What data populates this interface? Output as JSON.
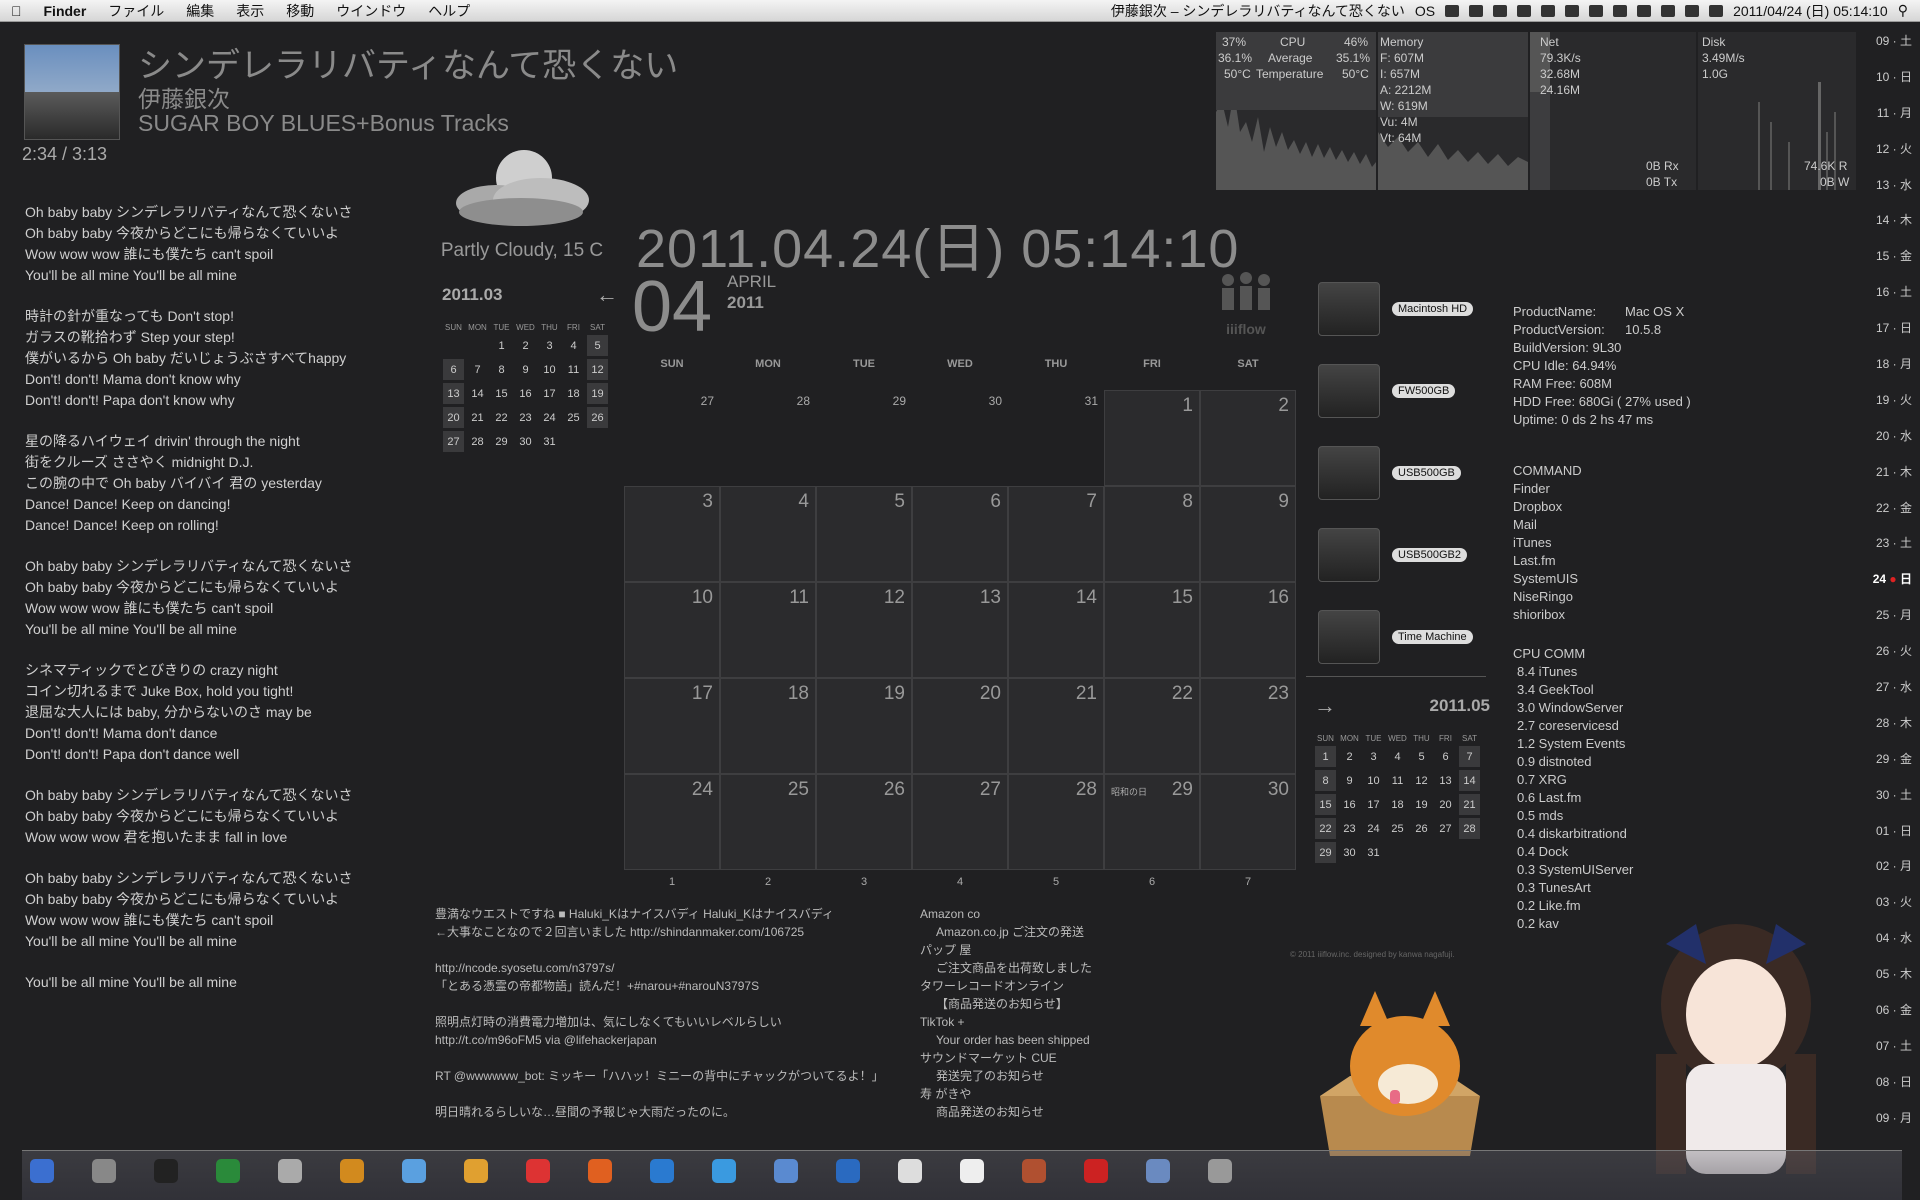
{
  "menubar": {
    "apple": "",
    "app": "Finder",
    "menus": [
      "ファイル",
      "編集",
      "表示",
      "移動",
      "ウインドウ",
      "ヘルプ"
    ],
    "now_playing": "伊藤銀次 – シンデレラリバティなんて恐くない",
    "os_label": "OS",
    "clock": "2011/04/24 (日) 05:14:10"
  },
  "now_playing": {
    "title": "シンデレラリバティなんて恐くない",
    "artist": "伊藤銀次",
    "album": "SUGAR BOY BLUES+Bonus Tracks",
    "time": "2:34 / 3:13"
  },
  "lyrics": [
    [
      "Oh baby baby シンデレラリバティなんて恐くないさ",
      "Oh baby baby 今夜からどこにも帰らなくていいよ",
      "Wow wow wow 誰にも僕たち can't spoil",
      "You'll be all mine You'll be all mine"
    ],
    [
      "時計の針が重なっても Don't stop!",
      "ガラスの靴拾わず Step your step!",
      "僕がいるから Oh baby だいじょうぶさすべてhappy",
      "Don't! don't! Mama don't know why",
      "Don't! don't! Papa don't know why"
    ],
    [
      "星の降るハイウェイ drivin' through the night",
      "街をクルーズ ささやく midnight D.J.",
      "この腕の中で Oh baby バイバイ 君の yesterday",
      "Dance! Dance! Keep on dancing!",
      "Dance! Dance! Keep on rolling!"
    ],
    [
      "Oh baby baby シンデレラリバティなんて恐くないさ",
      "Oh baby baby 今夜からどこにも帰らなくていいよ",
      "Wow wow wow 誰にも僕たち can't spoil",
      "You'll be all mine You'll be all mine"
    ],
    [
      "シネマティックでとびきりの crazy night",
      "コイン切れるまで Juke Box, hold you tight!",
      "退屈な大人には baby, 分からないのさ may be",
      "Don't! don't! Mama don't dance",
      "Don't! don't! Papa don't dance well"
    ],
    [
      "Oh baby baby シンデレラリバティなんて恐くないさ",
      "Oh baby baby 今夜からどこにも帰らなくていいよ",
      "Wow wow wow 君を抱いたまま fall in love"
    ],
    [
      "Oh baby baby シンデレラリバティなんて恐くないさ",
      "Oh baby baby 今夜からどこにも帰らなくていいよ",
      "Wow wow wow 誰にも僕たち can't spoil",
      "You'll be all mine You'll be all mine"
    ],
    [
      "You'll be all mine You'll be all mine"
    ]
  ],
  "weather": {
    "text": "Partly Cloudy, 15 C"
  },
  "mini_prev": {
    "title": "2011.03",
    "days": [
      "SUN",
      "MON",
      "TUE",
      "WED",
      "THU",
      "FRI",
      "SAT"
    ],
    "weeks": [
      [
        "",
        "",
        "1",
        "2",
        "3",
        "4",
        "5"
      ],
      [
        "6",
        "7",
        "8",
        "9",
        "10",
        "11",
        "12"
      ],
      [
        "13",
        "14",
        "15",
        "16",
        "17",
        "18",
        "19"
      ],
      [
        "20",
        "21",
        "22",
        "23",
        "24",
        "25",
        "26"
      ],
      [
        "27",
        "28",
        "29",
        "30",
        "31",
        "",
        ""
      ]
    ]
  },
  "mini_next": {
    "title": "2011.05",
    "days": [
      "SUN",
      "MON",
      "TUE",
      "WED",
      "THU",
      "FRI",
      "SAT"
    ],
    "weeks": [
      [
        "1",
        "2",
        "3",
        "4",
        "5",
        "6",
        "7"
      ],
      [
        "8",
        "9",
        "10",
        "11",
        "12",
        "13",
        "14"
      ],
      [
        "15",
        "16",
        "17",
        "18",
        "19",
        "20",
        "21"
      ],
      [
        "22",
        "23",
        "24",
        "25",
        "26",
        "27",
        "28"
      ],
      [
        "29",
        "30",
        "31",
        "",
        "",
        "",
        ""
      ]
    ]
  },
  "clock": {
    "datetime": "2011.04.24(日) 05:14:10",
    "day": "04",
    "month": "APRIL",
    "year": "2011",
    "logo": "iiiflow"
  },
  "calendar": {
    "weekdays": [
      "SUN",
      "MON",
      "TUE",
      "WED",
      "THU",
      "FRI",
      "SAT"
    ],
    "weeks": [
      [
        {
          "d": "27",
          "o": 1
        },
        {
          "d": "28",
          "o": 1
        },
        {
          "d": "29",
          "o": 1
        },
        {
          "d": "30",
          "o": 1
        },
        {
          "d": "31",
          "o": 1
        },
        {
          "d": "1"
        },
        {
          "d": "2"
        }
      ],
      [
        {
          "d": "3"
        },
        {
          "d": "4"
        },
        {
          "d": "5"
        },
        {
          "d": "6"
        },
        {
          "d": "7"
        },
        {
          "d": "8"
        },
        {
          "d": "9"
        }
      ],
      [
        {
          "d": "10"
        },
        {
          "d": "11"
        },
        {
          "d": "12"
        },
        {
          "d": "13"
        },
        {
          "d": "14"
        },
        {
          "d": "15"
        },
        {
          "d": "16"
        }
      ],
      [
        {
          "d": "17"
        },
        {
          "d": "18"
        },
        {
          "d": "19"
        },
        {
          "d": "20"
        },
        {
          "d": "21"
        },
        {
          "d": "22"
        },
        {
          "d": "23"
        }
      ],
      [
        {
          "d": "24"
        },
        {
          "d": "25"
        },
        {
          "d": "26"
        },
        {
          "d": "27"
        },
        {
          "d": "28"
        },
        {
          "d": "29",
          "h": "昭和の日"
        },
        {
          "d": "30"
        }
      ]
    ],
    "footer": [
      "1",
      "2",
      "3",
      "4",
      "5",
      "6",
      "7"
    ]
  },
  "tweets": [
    [
      "豊満なウエストですね ■ Haluki_Kはナイスバディ Haluki_Kはナイスバディ",
      "←大事なことなので２回言いました http://shindanmaker.com/106725"
    ],
    [
      "http://ncode.syosetu.com/n3797s/",
      "「とある憑霊の帝都物語」読んだ！+#narou+#narouN3797S"
    ],
    [
      "照明点灯時の消費電力増加は、気にしなくてもいいレベルらしい",
      "http://t.co/m96oFM5 via @lifehackerjapan"
    ],
    [
      "RT @wwwwww_bot: ミッキー「ハハッ！ミニーの背中にチャックがついてるよ！」"
    ],
    [
      "明日晴れるらしいな…昼間の予報じゃ大雨だったのに。"
    ]
  ],
  "mail": [
    {
      "from": "Amazon co",
      "subject": "Amazon.co.jp ご注文の発送"
    },
    {
      "from": "パップ 屋",
      "subject": "ご注文商品を出荷致しました"
    },
    {
      "from": "タワーレコードオンライン",
      "subject": "【商品発送のお知らせ】"
    },
    {
      "from": "TikTok +",
      "subject": "Your order has been shipped"
    },
    {
      "from": "サウンドマーケット CUE",
      "subject": "発送完了のお知らせ"
    },
    {
      "from": "寿 がきや",
      "subject": "商品発送のお知らせ"
    }
  ],
  "copyright": "© 2011 iiiflow.inc. designed by kanwa nagafuji.",
  "drives": [
    "Macintosh HD",
    "FW500GB",
    "USB500GB",
    "USB500GB2",
    "Time Machine"
  ],
  "sysinfo": [
    {
      "k": "ProductName:",
      "v": "Mac OS X"
    },
    {
      "k": "ProductVersion:",
      "v": "10.5.8"
    },
    {
      "k": "BuildVersion: 9L30",
      "v": ""
    },
    {
      "k": "CPU Idle: 64.94%",
      "v": ""
    },
    {
      "k": "RAM Free: 608M",
      "v": ""
    },
    {
      "k": "HDD Free: 680Gi ( 27% used )",
      "v": ""
    },
    {
      "k": "Uptime: 0 ds 2 hs 47 ms",
      "v": ""
    }
  ],
  "commands": {
    "title": "COMMAND",
    "items": [
      "Finder",
      "Dropbox",
      "Mail",
      "iTunes",
      "Last.fm",
      "SystemUIS",
      "NiseRingo",
      "shioribox"
    ]
  },
  "cpu_comm": {
    "title": "CPU COMM",
    "items": [
      "8.4 iTunes",
      "3.4 GeekTool",
      "3.0 WindowServer",
      "2.7 coreservicesd",
      "1.2 System Events",
      "0.9 distnoted",
      "0.7 XRG",
      "0.6 Last.fm",
      "0.5 mds",
      "0.4 diskarbitrationd",
      "0.4 Dock",
      "0.3 SystemUIServer",
      "0.3 TunesArt",
      "0.2 Like.fm",
      "0.2 kav"
    ]
  },
  "monitor": {
    "cpu_user": "37%",
    "cpu_sys": "36.1%",
    "cpu_temp1": "50°C",
    "cpu_title": "CPU",
    "cpu_avg_label": "Average",
    "cpu_temp_label": "Temperature",
    "cpu_pct": "46%",
    "cpu_avg": "35.1%",
    "cpu_temp2": "50°C",
    "mem_title": "Memory",
    "mem_lines": [
      "F: 607M",
      "I: 657M",
      "A: 2212M",
      "W: 619M",
      "Vu: 4M",
      "Vt: 64M"
    ],
    "net_title": "Net",
    "net_lines": [
      "79.3K/s",
      "32.68M",
      "24.16M"
    ],
    "net_rx": "0B Rx",
    "net_tx": "0B Tx",
    "disk_title": "Disk",
    "disk_lines": [
      "3.49M/s",
      "1.0G"
    ],
    "disk_r": "74.6K R",
    "disk_w": "0B W"
  },
  "datecol": [
    {
      "d": "09",
      "w": "土"
    },
    {
      "d": "10",
      "w": "日"
    },
    {
      "d": "11",
      "w": "月"
    },
    {
      "d": "12",
      "w": "火"
    },
    {
      "d": "13",
      "w": "水"
    },
    {
      "d": "14",
      "w": "木"
    },
    {
      "d": "15",
      "w": "金"
    },
    {
      "d": "16",
      "w": "土"
    },
    {
      "d": "17",
      "w": "日"
    },
    {
      "d": "18",
      "w": "月"
    },
    {
      "d": "19",
      "w": "火"
    },
    {
      "d": "20",
      "w": "水"
    },
    {
      "d": "21",
      "w": "木"
    },
    {
      "d": "22",
      "w": "金"
    },
    {
      "d": "23",
      "w": "土"
    },
    {
      "d": "24",
      "w": "日",
      "today": 1
    },
    {
      "d": "25",
      "w": "月"
    },
    {
      "d": "26",
      "w": "火"
    },
    {
      "d": "27",
      "w": "水"
    },
    {
      "d": "28",
      "w": "木"
    },
    {
      "d": "29",
      "w": "金"
    },
    {
      "d": "30",
      "w": "土"
    },
    {
      "d": "01",
      "w": "日"
    },
    {
      "d": "02",
      "w": "月"
    },
    {
      "d": "03",
      "w": "火"
    },
    {
      "d": "04",
      "w": "水"
    },
    {
      "d": "05",
      "w": "木"
    },
    {
      "d": "06",
      "w": "金"
    },
    {
      "d": "07",
      "w": "土"
    },
    {
      "d": "08",
      "w": "日"
    },
    {
      "d": "09",
      "w": "月"
    }
  ],
  "dock_icons": [
    "finder-icon",
    "system-preferences-icon",
    "terminal-icon",
    "activity-monitor-icon",
    "script-icon",
    "fetch-icon",
    "flow-icon",
    "pages-icon",
    "ical-icon",
    "firefox-icon",
    "safari-icon",
    "itunes-icon",
    "mail-icon",
    "app-store-icon",
    "preview-icon",
    "textedit-icon",
    "dictionary-icon",
    "lastfm-icon",
    "folder-icon",
    "trash-icon"
  ]
}
